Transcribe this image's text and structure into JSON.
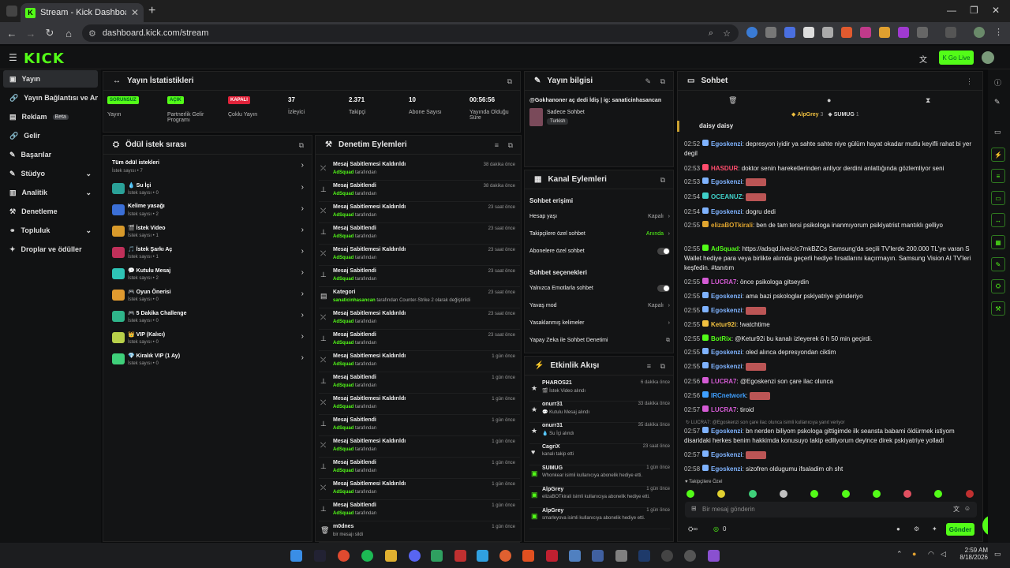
{
  "browser": {
    "tab_title": "Stream - Kick Dashboard",
    "url": "dashboard.kick.com/stream"
  },
  "app": {
    "logo": "KICK",
    "go_live": "Go Live"
  },
  "sidebar": {
    "items": [
      {
        "label": "Yayın",
        "icon": "broadcast-icon"
      },
      {
        "label": "Yayın Bağlantısı ve Anahtarı",
        "icon": "link-icon"
      },
      {
        "label": "Reklam",
        "badge": "Beta",
        "icon": "ad-icon"
      },
      {
        "label": "Gelir",
        "icon": "money-icon"
      },
      {
        "label": "Başarılar",
        "icon": "trophy-icon"
      },
      {
        "label": "Stüdyo",
        "icon": "studio-icon"
      },
      {
        "label": "Analitik",
        "icon": "chart-icon"
      },
      {
        "label": "Denetleme",
        "icon": "hammer-icon"
      },
      {
        "label": "Topluluk",
        "icon": "community-icon"
      },
      {
        "label": "Droplar ve ödüller",
        "icon": "gift-icon"
      }
    ]
  },
  "stats": {
    "title": "Yayın İstatistikleri",
    "items": [
      {
        "value": "SORUNSUZ",
        "label": "Yayın"
      },
      {
        "value": "AÇIK",
        "label": "Partnerlik Gelir Programı"
      },
      {
        "value": "KAPALI",
        "label": "Çoklu Yayın"
      },
      {
        "value": "37",
        "label": "İzleyici"
      },
      {
        "value": "2.371",
        "label": "Takipçi"
      },
      {
        "value": "10",
        "label": "Abone Sayısı"
      },
      {
        "value": "00:56:56",
        "label": "Yayında Olduğu Süre"
      }
    ]
  },
  "rewards": {
    "title": "Ödül istek sırası",
    "all": "Tüm ödül istekleri",
    "all_count": "İstek sayısı • 7",
    "items": [
      {
        "name": "💧 Su İçi",
        "count": "İstek sayısı • 0",
        "color": "#2aa198"
      },
      {
        "name": "Kelime yasağı",
        "count": "İstek sayısı • 2",
        "color": "#3b6fd6"
      },
      {
        "name": "🎬 İstek Video",
        "count": "İstek sayısı • 1",
        "color": "#d89a2b"
      },
      {
        "name": "🎵 İstek Şarkı Aç",
        "count": "İstek sayısı • 1",
        "color": "#c0305a"
      },
      {
        "name": "💬 Kutulu Mesaj",
        "count": "İstek sayısı • 2",
        "color": "#2ec4b6"
      },
      {
        "name": "🎮 Oyun Önerisi",
        "count": "İstek sayısı • 0",
        "color": "#e09a2f"
      },
      {
        "name": "🎮 5 Dakika Challenge",
        "count": "İstek sayısı • 0",
        "color": "#2fb58a"
      },
      {
        "name": "👑 VIP (Kalıcı)",
        "count": "İstek sayısı • 0",
        "color": "#b8d04a"
      },
      {
        "name": "💎 Kiralık VIP (1 Ay)",
        "count": "İstek sayısı • 0",
        "color": "#3fd07a"
      }
    ]
  },
  "moderation": {
    "title": "Denetim Eylemleri",
    "items": [
      {
        "name": "Mesaj Sabitlemesi Kaldırıldı",
        "by": "AdSquad",
        "sub": "tarafından",
        "time": "38 dakika önce"
      },
      {
        "name": "Mesaj Sabitlendi",
        "by": "AdSquad",
        "sub": "tarafından",
        "time": "38 dakika önce"
      },
      {
        "name": "Mesaj Sabitlemesi Kaldırıldı",
        "by": "AdSquad",
        "sub": "tarafından",
        "time": "23 saat önce"
      },
      {
        "name": "Mesaj Sabitlendi",
        "by": "AdSquad",
        "sub": "tarafından",
        "time": "23 saat önce"
      },
      {
        "name": "Mesaj Sabitlemesi Kaldırıldı",
        "by": "AdSquad",
        "sub": "tarafından",
        "time": "23 saat önce"
      },
      {
        "name": "Mesaj Sabitlendi",
        "by": "AdSquad",
        "sub": "tarafından",
        "time": "23 saat önce"
      },
      {
        "name": "Kategori",
        "by": "sanaticinhasancan",
        "sub": "tarafından Counter-Strike 2 olarak değiştirildi",
        "time": "23 saat önce"
      },
      {
        "name": "Mesaj Sabitlemesi Kaldırıldı",
        "by": "AdSquad",
        "sub": "tarafından",
        "time": "23 saat önce"
      },
      {
        "name": "Mesaj Sabitlendi",
        "by": "AdSquad",
        "sub": "tarafından",
        "time": "23 saat önce"
      },
      {
        "name": "Mesaj Sabitlemesi Kaldırıldı",
        "by": "AdSquad",
        "sub": "tarafından",
        "time": "1 gün önce"
      },
      {
        "name": "Mesaj Sabitlendi",
        "by": "AdSquad",
        "sub": "tarafından",
        "time": "1 gün önce"
      },
      {
        "name": "Mesaj Sabitlemesi Kaldırıldı",
        "by": "AdSquad",
        "sub": "tarafından",
        "time": "1 gün önce"
      },
      {
        "name": "Mesaj Sabitlendi",
        "by": "AdSquad",
        "sub": "tarafından",
        "time": "1 gün önce"
      },
      {
        "name": "Mesaj Sabitlemesi Kaldırıldı",
        "by": "AdSquad",
        "sub": "tarafından",
        "time": "1 gün önce"
      },
      {
        "name": "Mesaj Sabitlendi",
        "by": "AdSquad",
        "sub": "tarafından",
        "time": "1 gün önce"
      },
      {
        "name": "Mesaj Sabitlemesi Kaldırıldı",
        "by": "AdSquad",
        "sub": "tarafından",
        "time": "1 gün önce"
      },
      {
        "name": "Mesaj Sabitlendi",
        "by": "AdSquad",
        "sub": "tarafından",
        "time": "1 gün önce"
      },
      {
        "name": "m0dnes",
        "by": "",
        "sub": "bir mesajı sildi",
        "time": "1 gün önce"
      }
    ]
  },
  "stream_info": {
    "title": "Yayın bilgisi",
    "stream_title": "@Gokhanoner aç dedi İdiş | ig: sanaticinhasancan",
    "category": "Sadece Sohbet",
    "language": "Turkish"
  },
  "channel": {
    "title": "Kanal Eylemleri",
    "chat_access": "Sohbet erişimi",
    "rows1": [
      {
        "label": "Hesap yaşı",
        "value": "Kapalı"
      },
      {
        "label": "Takipçilere özel sohbet",
        "value": "Anında"
      },
      {
        "label": "Abonelere özel sohbet",
        "value": ""
      }
    ],
    "options": "Sohbet seçenekleri",
    "rows2": [
      {
        "label": "Yalnızca Emotlarla sohbet",
        "value": ""
      },
      {
        "label": "Yavaş mod",
        "value": "Kapalı"
      },
      {
        "label": "Yasaklanmış kelimeler",
        "value": ""
      },
      {
        "label": "Yapay Zeka ile Sohbet Denetimi",
        "value": ""
      }
    ]
  },
  "activity": {
    "title": "Etkinlik Akışı",
    "items": [
      {
        "name": "PHAROS21",
        "sub": "🎬 İstek Video alındı",
        "time": "6 dakika önce"
      },
      {
        "name": "onurr31",
        "sub": "💬 Kutulu Mesaj alındı",
        "time": "33 dakika önce"
      },
      {
        "name": "onurr31",
        "sub": "💧 Su İçi alındı",
        "time": "35 dakika önce"
      },
      {
        "name": "CagriX",
        "sub": "kanalı takip etti",
        "time": "23 saat önce"
      },
      {
        "name": "SUMUG",
        "sub": "Whonkear isimli kullanıcıya abonelik hediye etti.",
        "time": "1 gün önce"
      },
      {
        "name": "AlpGrey",
        "sub": "elizaBOTkirali isimli kullanıcıya abonelik hediye etti.",
        "time": "1 gün önce"
      },
      {
        "name": "AlpGrey",
        "sub": "smarleyova isimli kullanıcıya abonelik hediye etti.",
        "time": "1 gün önce"
      }
    ]
  },
  "chat": {
    "title": "Sohbet",
    "gifters": [
      {
        "name": "AlpGrey",
        "count": "3"
      },
      {
        "name": "SUMUG",
        "count": "1"
      }
    ],
    "pinned": "daisy daisy",
    "messages": [
      {
        "time": "02:52",
        "user": "Egoskenzi",
        "color": "#7fb3ff",
        "text": "depresyon iyidir ya sahte sahte niye gülüm hayat okadar mutlu keyifli rahat bi yer degil"
      },
      {
        "time": "02:53",
        "user": "HASDUR",
        "color": "#ff4d6d",
        "text": "doktor senin hareketlerinden anliyor derdini anlattığında gözlemliyor seni"
      },
      {
        "time": "02:53",
        "user": "Egoskenzi",
        "color": "#7fb3ff",
        "text": ""
      },
      {
        "time": "02:54",
        "user": "OCEANUZ",
        "color": "#3fd0c9",
        "text": ""
      },
      {
        "time": "02:54",
        "user": "Egoskenzi",
        "color": "#7fb3ff",
        "text": "dogru dedi"
      },
      {
        "time": "02:55",
        "user": "elizaBOTkirali",
        "color": "#e0a52f",
        "text": "ben de tam tersi psikologa inanmıyorum psikiyatrist mantıklı gelliyo"
      },
      {
        "time": "02:55",
        "user": "AdSquad",
        "color": "#53fc18",
        "text": "https://adsqd.live/c/c7mkBZCs Samsung'da seçili TV'lerde 200.000 TL'ye varan S Wallet hediye para veya birlikte alımda geçerli hediye fırsatlarını kaçırmayın. Samsung Vision AI TV'leri keşfedin. #tanıtım"
      },
      {
        "time": "02:55",
        "user": "LUCRA7",
        "color": "#d45bd4",
        "text": "önce psikologa gitseydin"
      },
      {
        "time": "02:55",
        "user": "Egoskenzi",
        "color": "#7fb3ff",
        "text": "ama bazi pskologlar pskiyatriye gönderiyo"
      },
      {
        "time": "02:55",
        "user": "Egoskenzi",
        "color": "#7fb3ff",
        "text": ""
      },
      {
        "time": "02:55",
        "user": "Ketur92i",
        "color": "#f0c040",
        "text": "!watchtime"
      },
      {
        "time": "02:55",
        "user": "BotRix",
        "color": "#53fc18",
        "text": "@Ketur92i bu kanalı izleyerek 6 h 50 min geçirdi."
      },
      {
        "time": "02:55",
        "user": "Egoskenzi",
        "color": "#7fb3ff",
        "text": "oled alınca depresyondan ciktim"
      },
      {
        "time": "02:55",
        "user": "Egoskenzi",
        "color": "#7fb3ff",
        "text": ""
      },
      {
        "time": "02:56",
        "user": "LUCRA7",
        "color": "#d45bd4",
        "text": "@Egoskenzi son çare ilac olunca"
      },
      {
        "time": "02:56",
        "user": "IRCnetwork",
        "color": "#3fa0ff",
        "text": ""
      },
      {
        "time": "02:57",
        "user": "LUCRA7",
        "color": "#d45bd4",
        "text": "tiroid"
      },
      {
        "time": "02:57",
        "user": "Egoskenzi",
        "color": "#7fb3ff",
        "text": "bn nerden biliyom pskologa gittigimde ilk seansta babami öldürmek istiyom disaridaki herkes benim hakkimda konusuyo takip ediliyorum deyince direk pskiyatriye yolladi"
      },
      {
        "time": "02:57",
        "user": "Egoskenzi",
        "color": "#7fb3ff",
        "text": ""
      },
      {
        "time": "02:58",
        "user": "Egoskenzi",
        "color": "#7fb3ff",
        "text": "sizofren oldugumu ifsaladim oh sht"
      }
    ],
    "reply_hint": "↻ LUCRA7: @Egoskenzi son çare ilac olunca isimli kullanıcıya yanıt veriyor",
    "followers_only": "♥ Takipçilere Özel",
    "placeholder": "Bir mesaj gönderin",
    "send": "Gönder",
    "points": "0"
  },
  "taskbar": {
    "time": "2:59 AM",
    "date": "8/18/2026"
  }
}
